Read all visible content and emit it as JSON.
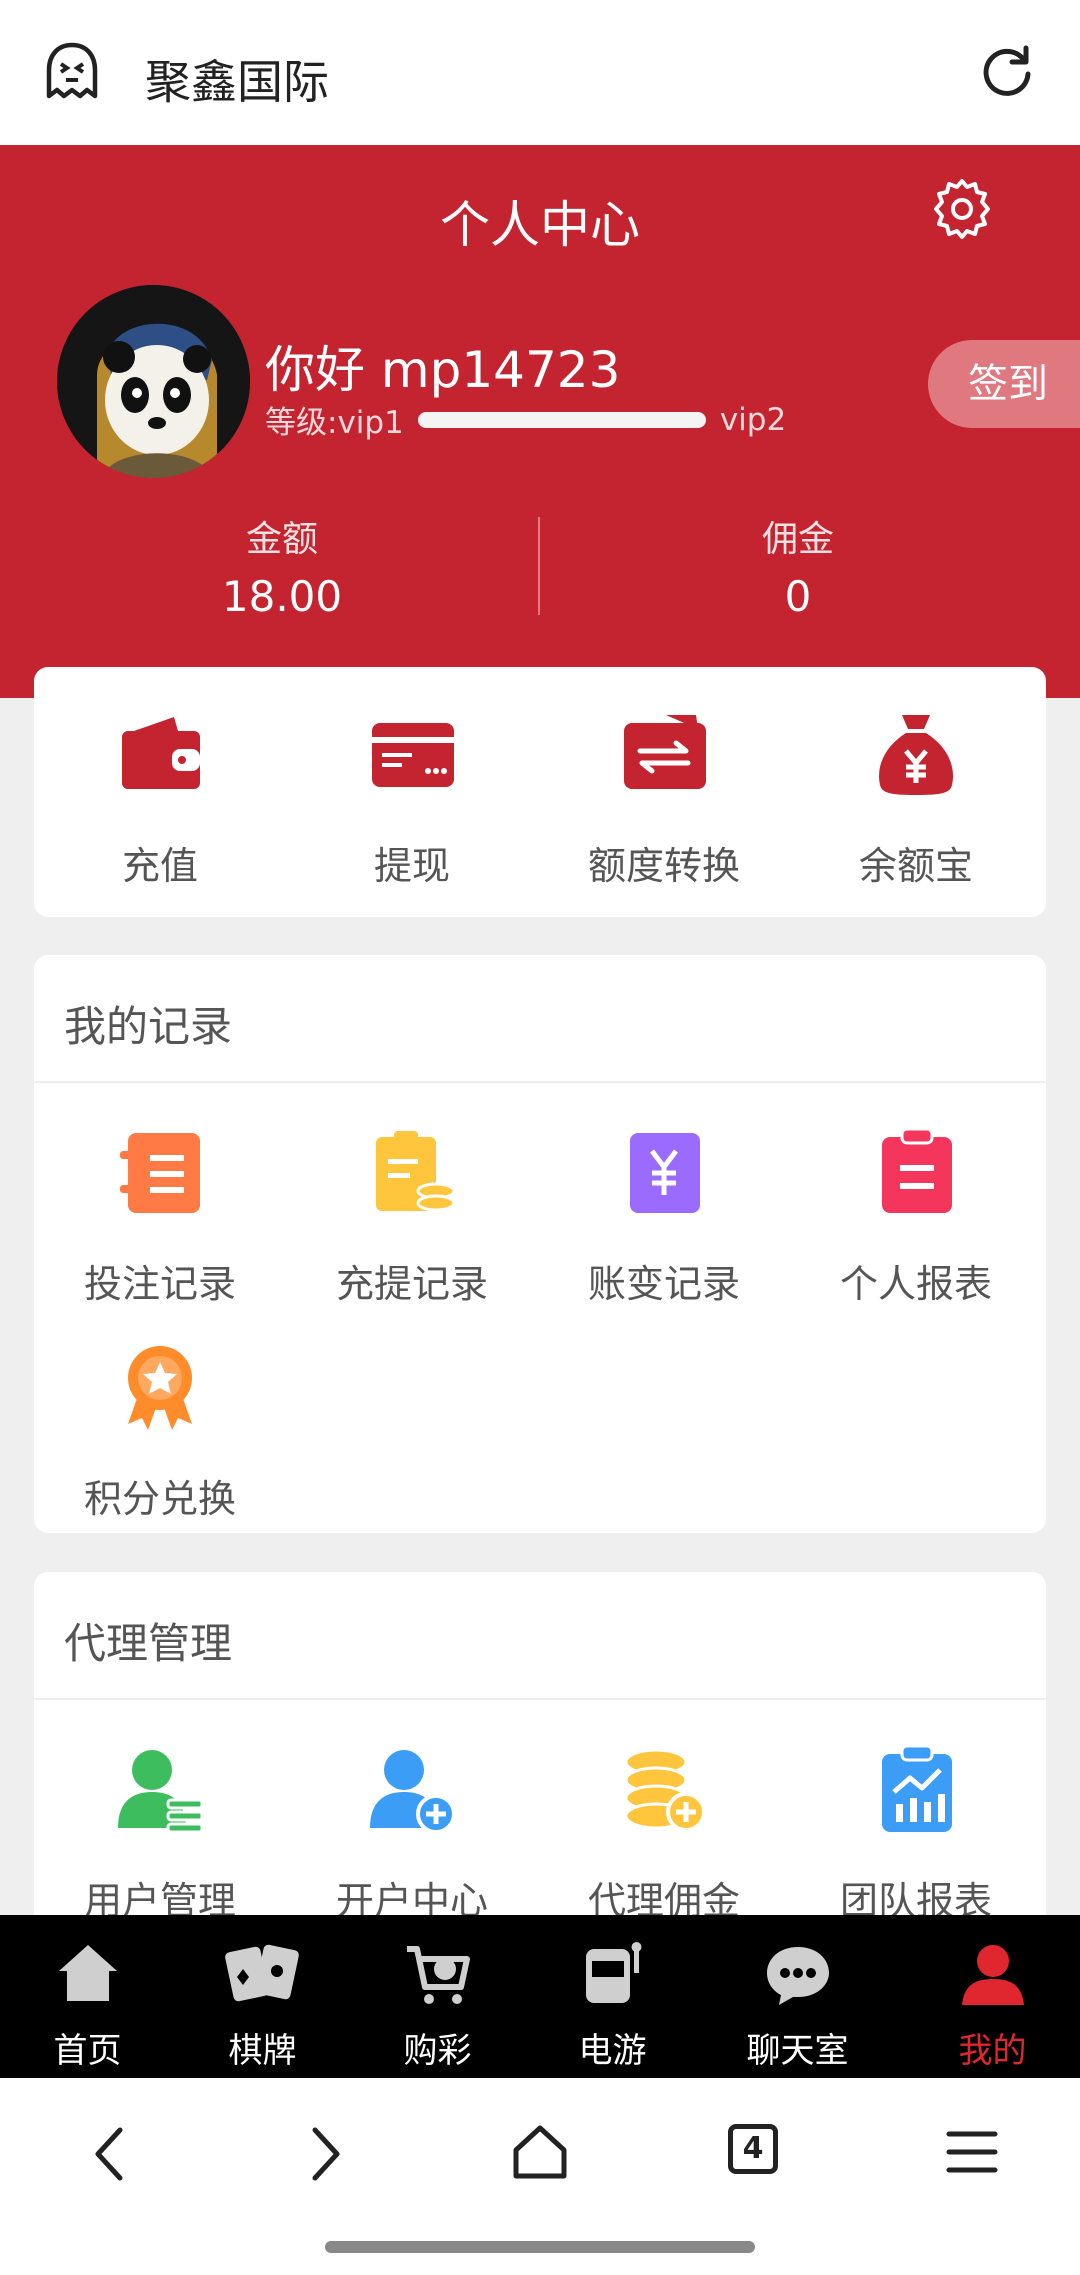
{
  "browser": {
    "site_title": "聚鑫国际"
  },
  "header": {
    "title": "个人中心",
    "greeting": "你好 mp14723",
    "level_prefix": "等级:vip1",
    "level_next": "vip2",
    "level_progress": 1.0,
    "checkin_label": "签到",
    "balance_label": "金额",
    "balance_value": "18.00",
    "commission_label": "佣金",
    "commission_value": "0"
  },
  "quick_actions": [
    {
      "label": "充值",
      "icon": "wallet-icon"
    },
    {
      "label": "提现",
      "icon": "card-icon"
    },
    {
      "label": "额度转换",
      "icon": "transfer-icon"
    },
    {
      "label": "余额宝",
      "icon": "money-bag-icon"
    }
  ],
  "records": {
    "title": "我的记录",
    "items": [
      {
        "label": "投注记录",
        "icon": "bet-record-icon",
        "color": "#ff7a45"
      },
      {
        "label": "充提记录",
        "icon": "deposit-record-icon",
        "color": "#ffc53d"
      },
      {
        "label": "账变记录",
        "icon": "account-change-icon",
        "color": "#9b6bff"
      },
      {
        "label": "个人报表",
        "icon": "personal-report-icon",
        "color": "#f5365c"
      },
      {
        "label": "积分兑换",
        "icon": "points-medal-icon",
        "color": "#ff8c2b"
      }
    ]
  },
  "agent": {
    "title": "代理管理",
    "items": [
      {
        "label": "用户管理",
        "icon": "user-manage-icon",
        "color": "#3dbd5e"
      },
      {
        "label": "开户中心",
        "icon": "add-user-icon",
        "color": "#3b9df5"
      },
      {
        "label": "代理佣金",
        "icon": "coins-icon",
        "color": "#ffc53d"
      },
      {
        "label": "团队报表",
        "icon": "team-report-icon",
        "color": "#3b9df5"
      }
    ]
  },
  "tabbar": [
    {
      "label": "首页",
      "icon": "home-icon"
    },
    {
      "label": "棋牌",
      "icon": "cards-icon"
    },
    {
      "label": "购彩",
      "icon": "lottery-cart-icon"
    },
    {
      "label": "电游",
      "icon": "slot-machine-icon"
    },
    {
      "label": "聊天室",
      "icon": "chat-icon"
    },
    {
      "label": "我的",
      "icon": "profile-icon",
      "active": true
    }
  ],
  "browser_nav": {
    "tab_count": "4"
  },
  "colors": {
    "brand_red": "#c42430",
    "active_tab": "#e0262f"
  }
}
